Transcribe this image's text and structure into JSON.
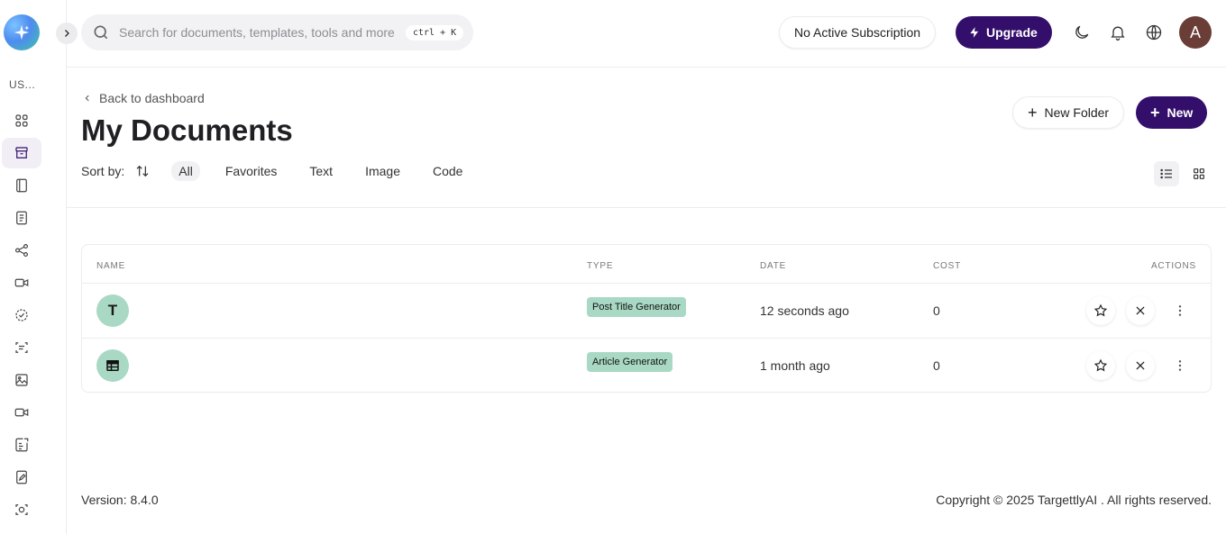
{
  "sidebar": {
    "workspace_label": "US...",
    "items": [
      {
        "icon": "dashboard-grid-icon"
      },
      {
        "icon": "archive-box-icon",
        "active": true
      },
      {
        "icon": "notebook-icon"
      },
      {
        "icon": "document-icon"
      },
      {
        "icon": "share-nodes-icon"
      },
      {
        "icon": "video-camera-icon"
      },
      {
        "icon": "dashed-check-circle-icon"
      },
      {
        "icon": "scan-text-icon"
      },
      {
        "icon": "image-icon"
      },
      {
        "icon": "video-icon"
      },
      {
        "icon": "document-list-icon"
      },
      {
        "icon": "document-edit-icon"
      },
      {
        "icon": "scan-face-icon"
      }
    ]
  },
  "topbar": {
    "search_placeholder": "Search for documents, templates, tools and more",
    "shortcut": "ctrl + K",
    "subscription": "No Active Subscription",
    "upgrade_label": "Upgrade",
    "avatar_initial": "A"
  },
  "header": {
    "back_label": "Back to dashboard",
    "title": "My Documents",
    "new_folder_label": "New Folder",
    "new_label": "New",
    "sort_label": "Sort by:",
    "filters": [
      "All",
      "Favorites",
      "Text",
      "Image",
      "Code"
    ],
    "active_filter": "All"
  },
  "table": {
    "columns": [
      "NAME",
      "TYPE",
      "DATE",
      "COST",
      "ACTIONS"
    ],
    "rows": [
      {
        "avatar": "T",
        "type": "Post Title Generator",
        "date": "12 seconds ago",
        "cost": "0"
      },
      {
        "avatar_icon": "table-icon",
        "type": "Article Generator",
        "date": "1 month ago",
        "cost": "0"
      }
    ]
  },
  "footer": {
    "version": "Version: 8.4.0",
    "copyright": "Copyright © 2025 TargettlyAI . All rights reserved."
  },
  "colors": {
    "brand": "#330f6b",
    "badge_bg": "#a9d9c4",
    "active_bg": "#f1eff5"
  }
}
